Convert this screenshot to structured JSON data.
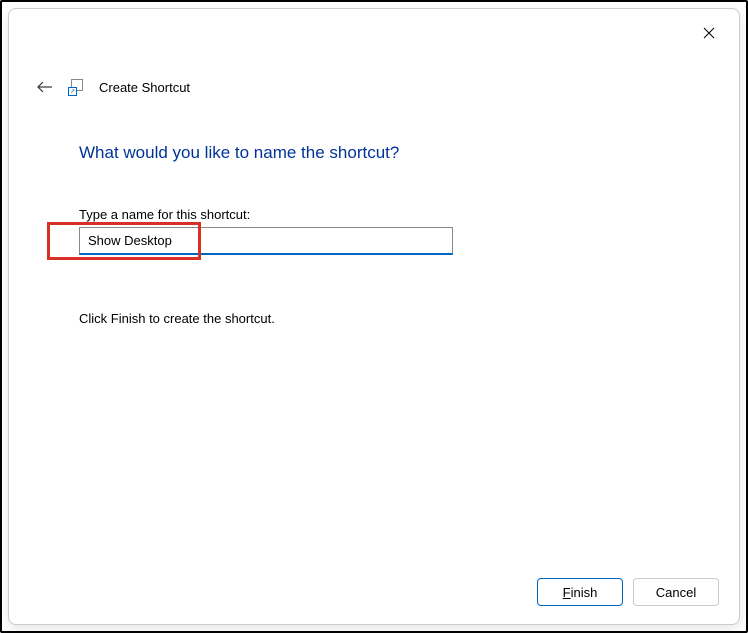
{
  "header": {
    "title": "Create Shortcut"
  },
  "main": {
    "heading": "What would you like to name the shortcut?",
    "prompt_label": "Type a name for this shortcut:",
    "input_value": "Show Desktop",
    "instruction": "Click Finish to create the shortcut."
  },
  "buttons": {
    "finish_prefix": "F",
    "finish_suffix": "inish",
    "cancel": "Cancel"
  }
}
